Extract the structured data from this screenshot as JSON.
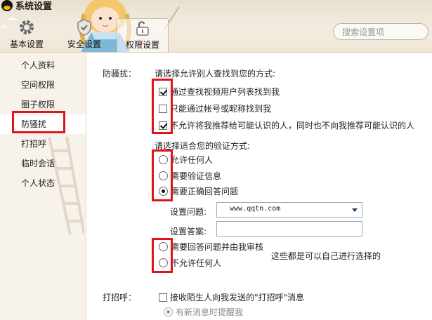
{
  "window": {
    "title": "系统设置"
  },
  "nav": {
    "tabs": [
      {
        "label": "基本设置",
        "icon": "gear-icon"
      },
      {
        "label": "安全设置",
        "icon": "shield-icon"
      },
      {
        "label": "权限设置",
        "icon": "unlock-icon"
      }
    ],
    "active_tab": "权限设置"
  },
  "search": {
    "placeholder": "搜索设置项"
  },
  "sidebar": {
    "items": [
      {
        "label": "个人资料"
      },
      {
        "label": "空间权限"
      },
      {
        "label": "圈子权限"
      },
      {
        "label": "防骚扰"
      },
      {
        "label": "打招呼"
      },
      {
        "label": "临时会话"
      },
      {
        "label": "个人状态"
      }
    ],
    "selected": "防骚扰"
  },
  "anti_harass": {
    "label": "防骚扰：",
    "find_prompt": "请选择允许别人查找到您的方式:",
    "find_options": [
      {
        "label": "通过查找视频用户列表找到我",
        "checked": true
      },
      {
        "label": "只能通过帐号或昵称找到我",
        "checked": false
      },
      {
        "label": "不允许将我推荐给可能认识的人，同时也不向我推荐可能认识的人",
        "checked": true
      }
    ],
    "verify_prompt": "请选择适合您的验证方式:",
    "verify_options_top": [
      {
        "label": "允许任何人",
        "checked": false
      },
      {
        "label": "需要验证信息",
        "checked": false
      },
      {
        "label": "需要正确回答问题",
        "checked": true
      }
    ],
    "question_label": "设置问题:",
    "question_value": "www.qqtn.com",
    "answer_label": "设置答案:",
    "answer_value": "",
    "verify_options_bottom": [
      {
        "label": "需要回答问题并由我审核",
        "checked": false
      },
      {
        "label": "不允许任何人",
        "checked": false
      }
    ],
    "note": "这些都是可以自己进行选择的"
  },
  "greeting": {
    "label": "打招呼：",
    "option": {
      "label": "接收陌生人向我发送的\"打招呼\"消息",
      "checked": false
    },
    "sub_option": {
      "label": "有新消息时提醒我",
      "checked": true
    }
  },
  "colors": {
    "highlight_box": "#e3131b",
    "header_bg": "#efe6d4",
    "sidebar_bg": "#f7f2ea"
  }
}
